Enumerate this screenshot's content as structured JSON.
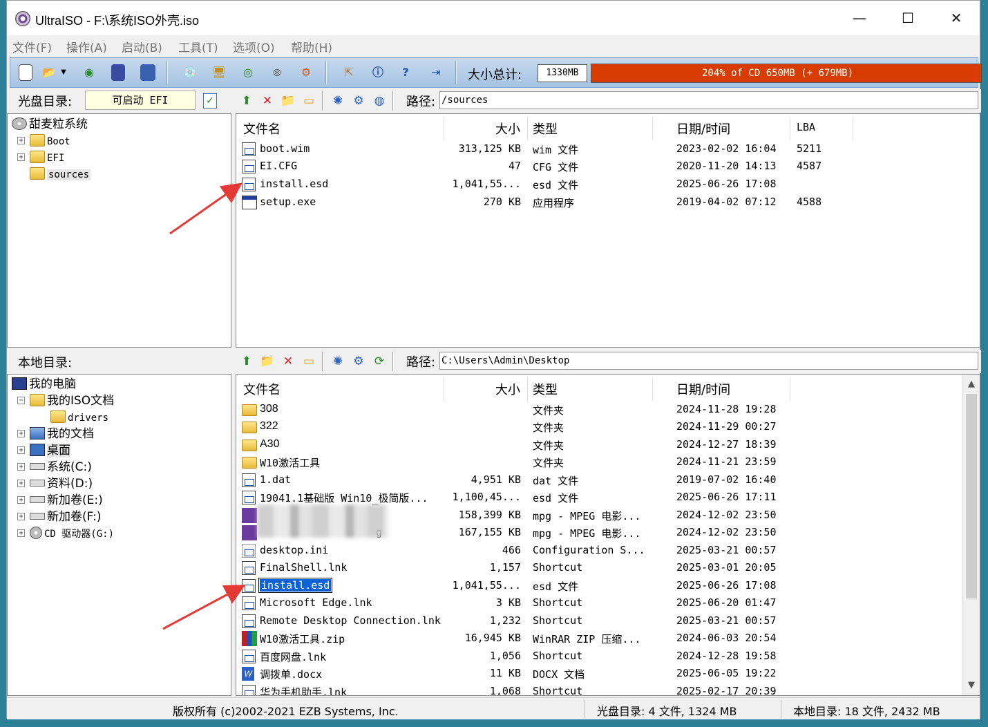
{
  "window": {
    "title": "UltraISO - F:\\系统ISO外壳.iso",
    "minimize": "—",
    "maximize": "☐",
    "close": "✕"
  },
  "menu": [
    "文件(F)",
    "操作(A)",
    "启动(B)",
    "工具(T)",
    "选项(O)",
    "帮助(H)"
  ],
  "toolbar": {
    "size_label": "大小总计:",
    "size_value": "1330MB",
    "capacity_text": "204% of CD 650MB (+ 679MB)",
    "capacity_color": "#d83c00"
  },
  "iso_pane": {
    "label": "光盘目录:",
    "boot_value": "可启动 EFI",
    "path_label": "路径:",
    "path": "/sources",
    "tree": [
      {
        "label": "甜麦粒系统"
      },
      {
        "label": "Boot"
      },
      {
        "label": "EFI"
      },
      {
        "label": "sources"
      }
    ],
    "headers": [
      "文件名",
      "大小",
      "类型",
      "日期/时间",
      "LBA"
    ],
    "files": [
      {
        "name": "boot.wim",
        "size": "313,125 KB",
        "type": "wim 文件",
        "date": "2023-02-02 16:04",
        "lba": "5211",
        "icon": "file"
      },
      {
        "name": "EI.CFG",
        "size": "47",
        "type": "CFG 文件",
        "date": "2020-11-20 14:13",
        "lba": "4587",
        "icon": "file"
      },
      {
        "name": "install.esd",
        "size": "1,041,55...",
        "type": "esd 文件",
        "date": "2025-06-26 17:08",
        "lba": "",
        "icon": "file"
      },
      {
        "name": "setup.exe",
        "size": "270 KB",
        "type": "应用程序",
        "date": "2019-04-02 07:12",
        "lba": "4588",
        "icon": "exe"
      }
    ]
  },
  "local_pane": {
    "label": "本地目录:",
    "path_label": "路径:",
    "path": "C:\\Users\\Admin\\Desktop",
    "tree": [
      {
        "label": "我的电脑"
      },
      {
        "label": "我的ISO文档"
      },
      {
        "label": "drivers"
      },
      {
        "label": "我的文档"
      },
      {
        "label": "桌面"
      },
      {
        "label": "系统(C:)"
      },
      {
        "label": "资料(D:)"
      },
      {
        "label": "新加卷(E:)"
      },
      {
        "label": "新加卷(F:)"
      },
      {
        "label": "CD 驱动器(G:)"
      }
    ],
    "headers": [
      "文件名",
      "大小",
      "类型",
      "日期/时间"
    ],
    "files": [
      {
        "name": "308",
        "size": "",
        "type": "文件夹",
        "date": "2024-11-28 19:28",
        "icon": "folder"
      },
      {
        "name": "322",
        "size": "",
        "type": "文件夹",
        "date": "2024-11-29 00:27",
        "icon": "folder"
      },
      {
        "name": "A30",
        "size": "",
        "type": "文件夹",
        "date": "2024-12-27 18:39",
        "icon": "folder"
      },
      {
        "name": "W10激活工具",
        "size": "",
        "type": "文件夹",
        "date": "2024-11-21 23:59",
        "icon": "folder"
      },
      {
        "name": "1.dat",
        "size": "4,951 KB",
        "type": "dat 文件",
        "date": "2019-07-02 16:40",
        "icon": "file"
      },
      {
        "name": "19041.1基础版 Win10_极简版...",
        "size": "1,100,45...",
        "type": "esd 文件",
        "date": "2025-06-26 17:11",
        "icon": "file"
      },
      {
        "name": "",
        "size": "158,399 KB",
        "type": "mpg - MPEG 电影...",
        "date": "2024-12-02 23:50",
        "icon": "mpg"
      },
      {
        "name": "g",
        "size": "167,155 KB",
        "type": "mpg - MPEG 电影...",
        "date": "2024-12-02 23:50",
        "icon": "mpg"
      },
      {
        "name": "desktop.ini",
        "size": "466",
        "type": "Configuration S...",
        "date": "2025-03-21 00:57",
        "icon": "ini"
      },
      {
        "name": "FinalShell.lnk",
        "size": "1,157",
        "type": "Shortcut",
        "date": "2025-03-01 20:05",
        "icon": "file"
      },
      {
        "name": "install.esd",
        "size": "1,041,55...",
        "type": "esd 文件",
        "date": "2025-06-26 17:08",
        "icon": "file"
      },
      {
        "name": "Microsoft Edge.lnk",
        "size": "3 KB",
        "type": "Shortcut",
        "date": "2025-06-20 01:47",
        "icon": "file"
      },
      {
        "name": "Remote Desktop Connection.lnk",
        "size": "1,232",
        "type": "Shortcut",
        "date": "2025-03-21 00:57",
        "icon": "file"
      },
      {
        "name": "W10激活工具.zip",
        "size": "16,945 KB",
        "type": "WinRAR ZIP 压缩...",
        "date": "2024-06-03 20:54",
        "icon": "zip"
      },
      {
        "name": "百度网盘.lnk",
        "size": "1,056",
        "type": "Shortcut",
        "date": "2024-12-28 19:58",
        "icon": "file"
      },
      {
        "name": "调拨单.docx",
        "size": "11 KB",
        "type": "DOCX 文档",
        "date": "2025-06-05 19:22",
        "icon": "word"
      },
      {
        "name": "华为手机助手.lnk",
        "size": "1,068",
        "type": "Shortcut",
        "date": "2025-02-17 20:39",
        "icon": "file"
      }
    ]
  },
  "status": {
    "copyright": "版权所有 (c)2002-2021 EZB Systems, Inc.",
    "iso_summary": "光盘目录: 4 文件, 1324 MB",
    "local_summary": "本地目录: 18 文件, 2432 MB"
  },
  "annotation_color": "#e53935"
}
